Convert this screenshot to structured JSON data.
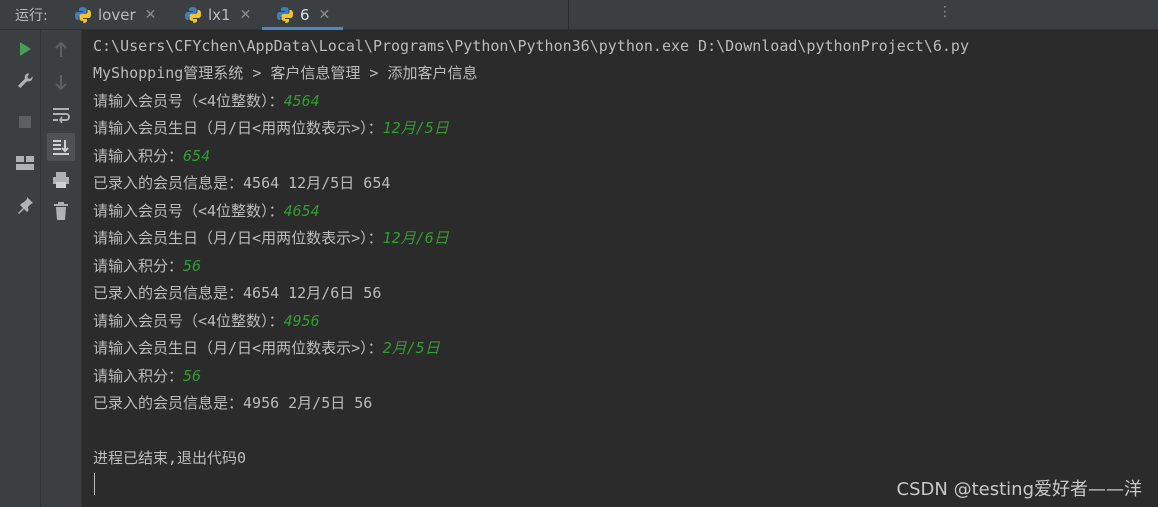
{
  "run_label": "运行:",
  "tabs": [
    {
      "label": "lover",
      "close": "✕"
    },
    {
      "label": "lx1",
      "close": "✕"
    },
    {
      "label": "6",
      "close": "✕"
    }
  ],
  "more_icon": "⋮",
  "console": {
    "command": "C:\\Users\\CFYchen\\AppData\\Local\\Programs\\Python\\Python36\\python.exe D:\\Download\\pythonProject\\6.py",
    "breadcrumb": "MyShopping管理系统 > 客户信息管理 > 添加客户信息",
    "entries": [
      {
        "id_prompt": "请输入会员号（<4位整数）：",
        "id_value": "4564",
        "bday_prompt": "请输入会员生日（月/日<用两位数表示>）：",
        "bday_value": "12月/5日",
        "points_prompt": "请输入积分：",
        "points_value": "654",
        "summary": "已录入的会员信息是：4564 12月/5日 654"
      },
      {
        "id_prompt": "请输入会员号（<4位整数）：",
        "id_value": "4654",
        "bday_prompt": "请输入会员生日（月/日<用两位数表示>）：",
        "bday_value": "12月/6日",
        "points_prompt": "请输入积分：",
        "points_value": "56",
        "summary": "已录入的会员信息是：4654 12月/6日 56"
      },
      {
        "id_prompt": "请输入会员号（<4位整数）：",
        "id_value": "4956",
        "bday_prompt": "请输入会员生日（月/日<用两位数表示>）：",
        "bday_value": "2月/5日",
        "points_prompt": "请输入积分：",
        "points_value": "56",
        "summary": "已录入的会员信息是：4956 2月/5日 56"
      }
    ],
    "exit_message": "进程已结束,退出代码0"
  },
  "watermark": "CSDN @testing爱好者——洋",
  "colors": {
    "input_text": "#2e9e2e",
    "console_bg": "#2b2b2b",
    "accent": "#4a88c7"
  }
}
